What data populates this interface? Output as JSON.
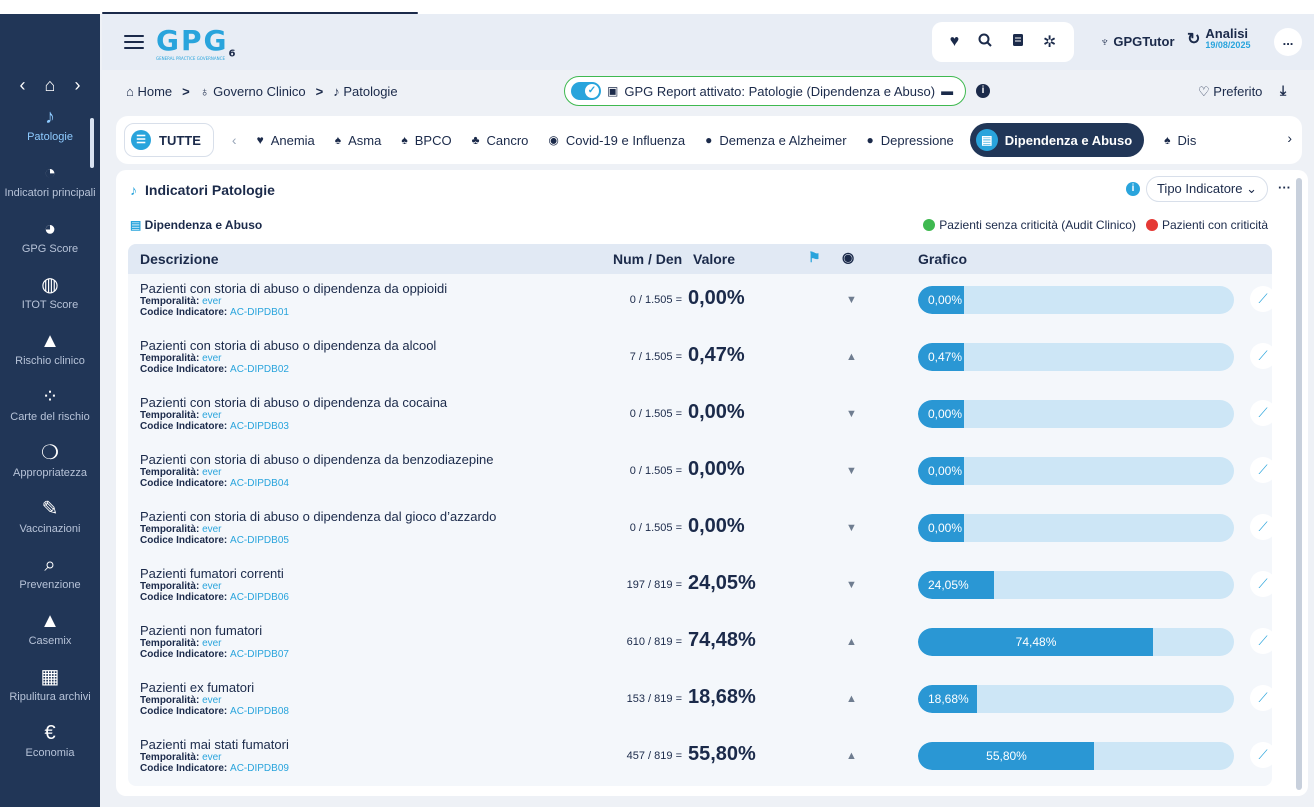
{
  "app": {
    "logo_text": "GPG",
    "logo_suffix": "6",
    "logo_tagline": "GENERAL PRACTICE GOVERNANCE"
  },
  "sidebar": {
    "items": [
      {
        "label": "Patologie",
        "icon": "bell-icon",
        "active": true
      },
      {
        "label": "Indicatori principali",
        "icon": "pie-chart-icon"
      },
      {
        "label": "GPG Score",
        "icon": "gauge-icon"
      },
      {
        "label": "ITOT Score",
        "icon": "pulse-gauge-icon"
      },
      {
        "label": "Rischio clinico",
        "icon": "warning-icon"
      },
      {
        "label": "Carte del rischio",
        "icon": "grid-dots-icon"
      },
      {
        "label": "Appropriatezza",
        "icon": "pills-icon"
      },
      {
        "label": "Vaccinazioni",
        "icon": "syringe-icon"
      },
      {
        "label": "Prevenzione",
        "icon": "magnifier-icon"
      },
      {
        "label": "Casemix",
        "icon": "weight-icon"
      },
      {
        "label": "Ripulitura archivi",
        "icon": "archive-icon"
      },
      {
        "label": "Economia",
        "icon": "euro-icon"
      }
    ]
  },
  "header": {
    "tutor_label": "GPGTutor",
    "analisi_label": "Analisi",
    "analisi_date": "19/08/2025",
    "more_label": "..."
  },
  "breadcrumb": {
    "items": [
      "Home",
      "Governo Clinico",
      "Patologie"
    ],
    "separator": ">"
  },
  "report": {
    "label": "GPG Report attivato: Patologie (Dipendenza e Abuso)"
  },
  "actions": {
    "preferito_label": "Preferito"
  },
  "tabs": {
    "all_label": "TUTTE",
    "items": [
      {
        "label": "Anemia"
      },
      {
        "label": "Asma"
      },
      {
        "label": "BPCO"
      },
      {
        "label": "Cancro"
      },
      {
        "label": "Covid-19 e Influenza"
      },
      {
        "label": "Demenza e Alzheimer"
      },
      {
        "label": "Depressione"
      },
      {
        "label": "Dipendenza e Abuso",
        "active": true
      },
      {
        "label": "Dis"
      }
    ]
  },
  "panel": {
    "title": "Indicatori Patologie",
    "filter_label": "Tipo Indicatore",
    "subtitle": "Dipendenza e Abuso",
    "legend": [
      {
        "label": "Pazienti senza criticità (Audit Clinico)",
        "color": "#3fb950"
      },
      {
        "label": "Pazienti con criticità",
        "color": "#e53935"
      }
    ],
    "columns": {
      "descrizione": "Descrizione",
      "numden": "Num / Den",
      "valore": "Valore",
      "grafico": "Grafico"
    },
    "temporalita_label": "Temporalità:",
    "codice_label": "Codice Indicatore:",
    "rows": [
      {
        "desc": "Pazienti con storia di abuso o dipendenza da oppioidi",
        "temporalita": "ever",
        "codice": "AC-DIPDB01",
        "numden": "0 / 1.505 =",
        "valore": "0,00%",
        "trend": "down",
        "pct": 0
      },
      {
        "desc": "Pazienti con storia di abuso o dipendenza da alcool",
        "temporalita": "ever",
        "codice": "AC-DIPDB02",
        "numden": "7 / 1.505 =",
        "valore": "0,47%",
        "trend": "up",
        "pct": 0.47
      },
      {
        "desc": "Pazienti con storia di abuso o dipendenza da cocaina",
        "temporalita": "ever",
        "codice": "AC-DIPDB03",
        "numden": "0 / 1.505 =",
        "valore": "0,00%",
        "trend": "down",
        "pct": 0
      },
      {
        "desc": "Pazienti con storia di abuso o dipendenza da benzodiazepine",
        "temporalita": "ever",
        "codice": "AC-DIPDB04",
        "numden": "0 / 1.505 =",
        "valore": "0,00%",
        "trend": "down",
        "pct": 0
      },
      {
        "desc": "Pazienti con storia di abuso o dipendenza dal gioco d’azzardo",
        "temporalita": "ever",
        "codice": "AC-DIPDB05",
        "numden": "0 / 1.505 =",
        "valore": "0,00%",
        "trend": "down",
        "pct": 0
      },
      {
        "desc": "Pazienti fumatori correnti",
        "temporalita": "ever",
        "codice": "AC-DIPDB06",
        "numden": "197 / 819 =",
        "valore": "24,05%",
        "trend": "down",
        "pct": 24.05
      },
      {
        "desc": "Pazienti non fumatori",
        "temporalita": "ever",
        "codice": "AC-DIPDB07",
        "numden": "610 / 819 =",
        "valore": "74,48%",
        "trend": "up",
        "pct": 74.48
      },
      {
        "desc": "Pazienti ex fumatori",
        "temporalita": "ever",
        "codice": "AC-DIPDB08",
        "numden": "153 / 819 =",
        "valore": "18,68%",
        "trend": "up",
        "pct": 18.68
      },
      {
        "desc": "Pazienti mai stati fumatori",
        "temporalita": "ever",
        "codice": "AC-DIPDB09",
        "numden": "457 / 819 =",
        "valore": "55,80%",
        "trend": "up",
        "pct": 55.8
      }
    ]
  },
  "colors": {
    "sidebar_bg": "#213657",
    "accent": "#29a4dc",
    "bar_fill": "#2a97d4",
    "bar_track": "#cde6f6"
  }
}
